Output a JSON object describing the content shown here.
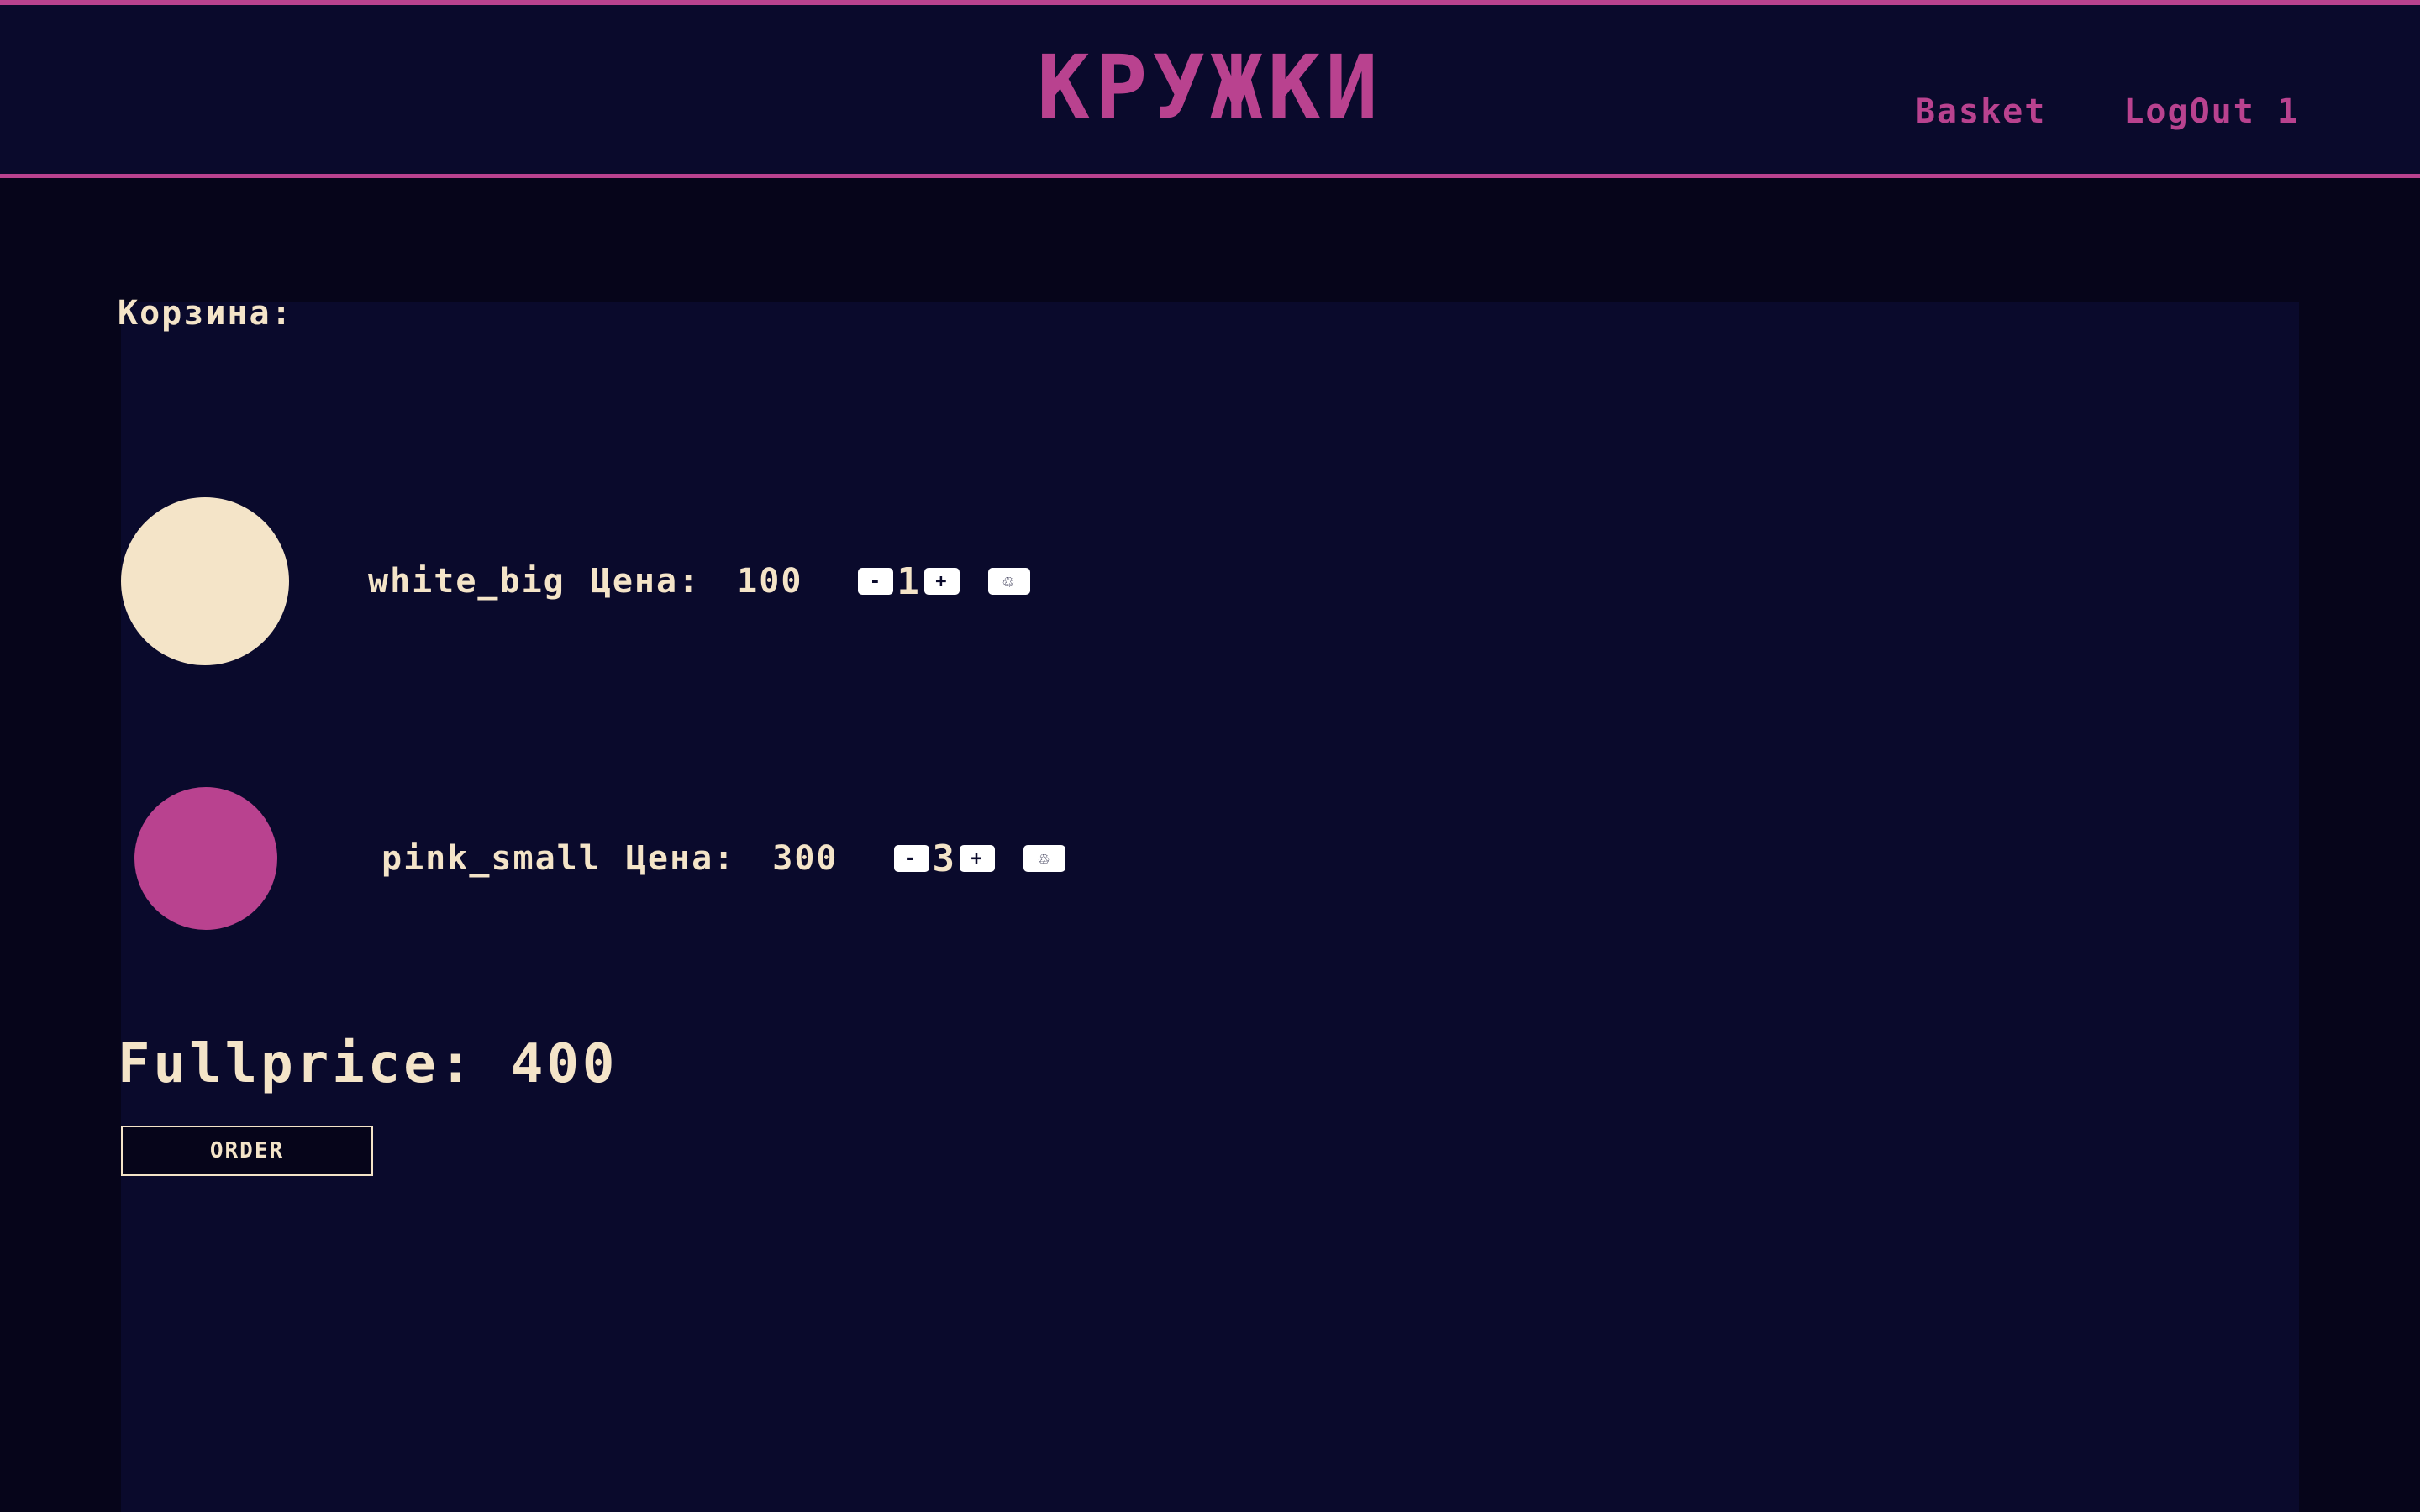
{
  "header": {
    "logo": "КРУЖКИ",
    "nav": {
      "basket": "Basket",
      "logout": "LogOut 1"
    }
  },
  "cart": {
    "title": "Корзина:",
    "items": [
      {
        "name": "white_big",
        "price_label": "Цена:",
        "price": "100",
        "quantity": "1",
        "minus": "-",
        "plus": "+",
        "delete_icon": "♲",
        "color": "#f4e4c8"
      },
      {
        "name": "pink_small",
        "price_label": "Цена:",
        "price": "300",
        "quantity": "3",
        "minus": "-",
        "plus": "+",
        "delete_icon": "♲",
        "color": "#b9428f"
      }
    ],
    "fullprice_label": "Fullprice:",
    "fullprice": "400",
    "order_label": "ORDER"
  },
  "colors": {
    "accent": "#b9428f",
    "text": "#f4e4c8",
    "panel": "#0a0a2c",
    "background": "#06051a"
  }
}
